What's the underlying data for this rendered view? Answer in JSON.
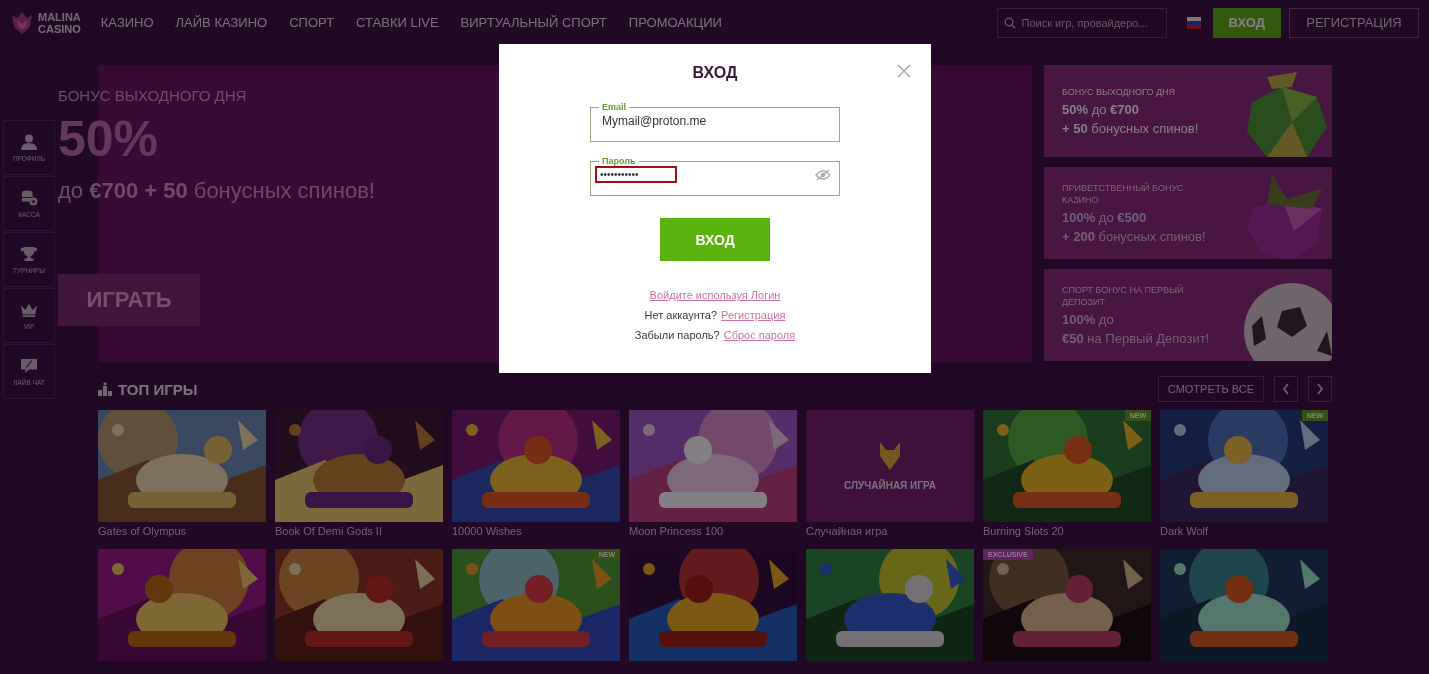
{
  "header": {
    "logo": {
      "line1": "MALINA",
      "line2": "CASINO"
    },
    "nav": [
      {
        "label": "КАЗИНО"
      },
      {
        "label": "ЛАЙВ КАЗИНО"
      },
      {
        "label": "СПОРТ"
      },
      {
        "label": "СТАВКИ LIVE"
      },
      {
        "label": "ВИРТУАЛЬНЫЙ СПОРТ"
      },
      {
        "label": "ПРОМОАКЦИИ"
      }
    ],
    "search": {
      "placeholder": "Поиск игр, провайдеро..."
    },
    "login": "ВХОД",
    "register": "РЕГИСТРАЦИЯ"
  },
  "sidebar": [
    {
      "label": "ПРОФИЛЬ",
      "kind": "person"
    },
    {
      "label": "КАССА",
      "kind": "coins"
    },
    {
      "label": "ТУРНИРЫ",
      "kind": "trophy"
    },
    {
      "label": "VIP",
      "kind": "crown"
    },
    {
      "label": "ЛАЙВ ЧАТ",
      "kind": "chat"
    }
  ],
  "hero": {
    "kicker": "БОНУС ВЫХОДНОГО ДНЯ",
    "headline": "50%",
    "subline": "до **€700 + 50** бонусных спинов!",
    "button": "ИГРАТЬ"
  },
  "promos": [
    {
      "kicker": "БОНУС ВЫХОДНОГО ДНЯ",
      "line1": "**50%** до **€700**",
      "line2": "**+ 50** бонусных спинов!",
      "selected": true,
      "kind": "apple"
    },
    {
      "kicker": "ПРИВЕТСТВЕННЫЙ БОНУС КАЗИНО",
      "line1": "**100%** до **€500**",
      "line2": "**+ 200** бонусных спинов!",
      "selected": false,
      "kind": "berry"
    },
    {
      "kicker": "СПОРТ БОНУС НА ПЕРВЫЙ ДЕПОЗИТ",
      "line1": "**100%** до",
      "line2": "**€50** на Первый Депозит!",
      "selected": false,
      "kind": "ball"
    }
  ],
  "top_games": {
    "title": "ТОП ИГРЫ",
    "view_all": "СМОТРЕТЬ ВСЕ",
    "games": [
      {
        "kind": "picture",
        "caption": "Gates of Olympus"
      },
      {
        "kind": "picture",
        "caption": "Book Of Demi Gods II"
      },
      {
        "kind": "picture",
        "caption": "10000 Wishes"
      },
      {
        "kind": "picture",
        "caption": "Moon Princess 100"
      },
      {
        "kind": "random",
        "label": "СЛУЧАЙНАЯ ИГРА",
        "caption": "Случайная игра"
      },
      {
        "kind": "picture",
        "caption": "Burning Slots 20",
        "badge": "NEW"
      },
      {
        "kind": "picture",
        "caption": "Dark Wolf",
        "badge": "NEW"
      },
      {
        "kind": "picture"
      },
      {
        "kind": "picture"
      },
      {
        "kind": "picture",
        "badge": "NEW"
      },
      {
        "kind": "picture"
      },
      {
        "kind": "picture"
      },
      {
        "kind": "picture",
        "badge": "EXCLUSIVE"
      },
      {
        "kind": "picture"
      }
    ]
  },
  "modal": {
    "title": "ВХОД",
    "email": {
      "label": "Email",
      "value": "Mymail@proton.me"
    },
    "password": {
      "label": "Пароль",
      "value": "•••••••••••",
      "highlighted": true
    },
    "submit": "ВХОД",
    "login_link": "Войдите используя Логин",
    "signup": {
      "text": "Нет аккаунта?",
      "link": "Регистрация"
    },
    "reset": {
      "text": "Забыли пароль?",
      "link": "Сброс пароля"
    }
  }
}
